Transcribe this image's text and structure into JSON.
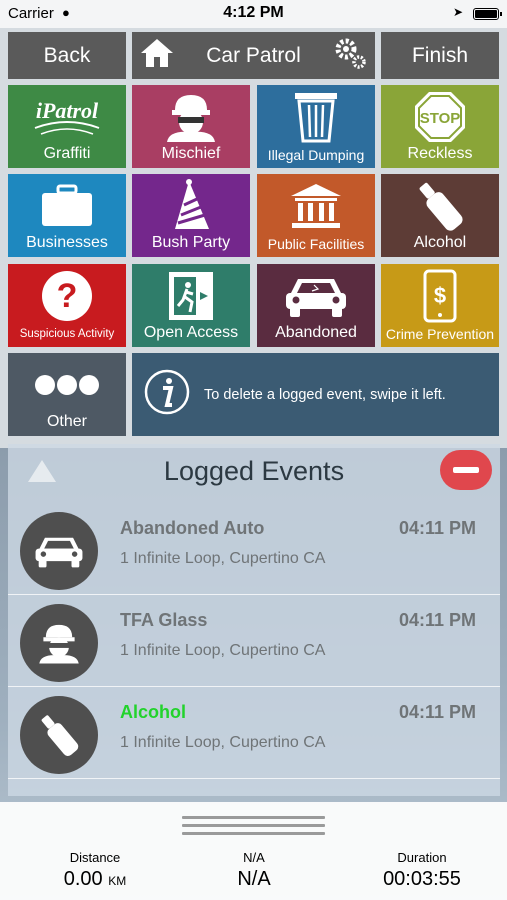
{
  "status_bar": {
    "carrier": "Carrier",
    "time": "4:12 PM"
  },
  "nav": {
    "back_label": "Back",
    "title": "Car Patrol",
    "finish_label": "Finish"
  },
  "tiles": [
    {
      "label": "Graffiti",
      "color": "#3e8a45",
      "icon": "graffiti-logo-icon"
    },
    {
      "label": "Mischief",
      "color": "#a93e63",
      "icon": "masked-burglar-icon"
    },
    {
      "label": "Illegal Dumping",
      "color": "#2d6e9d",
      "icon": "trash-can-icon"
    },
    {
      "label": "Reckless",
      "color": "#8aa538",
      "icon": "stop-sign-icon"
    },
    {
      "label": "Businesses",
      "color": "#1e88bf",
      "icon": "briefcase-icon"
    },
    {
      "label": "Bush Party",
      "color": "#74278c",
      "icon": "party-hat-icon"
    },
    {
      "label": "Public Facilities",
      "color": "#c2592a",
      "icon": "building-icon"
    },
    {
      "label": "Alcohol",
      "color": "#5d3c36",
      "icon": "bottle-icon"
    },
    {
      "label": "Suspicious Activity",
      "color": "#c81b1f",
      "icon": "question-mark-icon"
    },
    {
      "label": "Open Access",
      "color": "#2f7d6a",
      "icon": "exit-door-icon"
    },
    {
      "label": "Abandoned",
      "color": "#5a2c40",
      "icon": "damaged-car-icon"
    },
    {
      "label": "Crime Prevention",
      "color": "#c79a17",
      "icon": "phone-dollar-icon"
    },
    {
      "label": "Other",
      "color": "#4e5964",
      "icon": "three-dots-icon"
    }
  ],
  "info": {
    "text": "To delete a logged event, swipe it left."
  },
  "logged_events": {
    "title": "Logged Events",
    "items": [
      {
        "name": "Abandoned Auto",
        "address": "1 Infinite Loop, Cupertino CA",
        "time": "04:11 PM",
        "icon": "damaged-car-icon"
      },
      {
        "name": "TFA Glass",
        "address": "1 Infinite Loop, Cupertino CA",
        "time": "04:11 PM",
        "icon": "masked-burglar-icon"
      },
      {
        "name": "Alcohol",
        "address": "1 Infinite Loop, Cupertino CA",
        "time": "04:11 PM",
        "icon": "bottle-icon",
        "name_color": "#22d32c"
      }
    ]
  },
  "stats": {
    "distance": {
      "label": "Distance",
      "value": "0.00",
      "unit": "KM"
    },
    "middle": {
      "label": "N/A",
      "value": "N/A"
    },
    "duration": {
      "label": "Duration",
      "value": "00:03:55"
    }
  }
}
